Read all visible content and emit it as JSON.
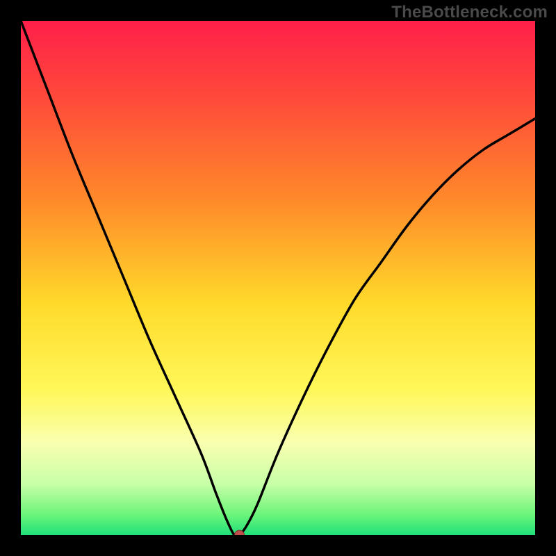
{
  "watermark": "TheBottleneck.com",
  "chart_data": {
    "type": "line",
    "title": "",
    "xlabel": "",
    "ylabel": "",
    "xlim": [
      0,
      100
    ],
    "ylim": [
      0,
      100
    ],
    "grid": false,
    "series": [
      {
        "name": "bottleneck-curve",
        "x": [
          0,
          5,
          10,
          15,
          20,
          25,
          30,
          35,
          38,
          40,
          41.5,
          42.5,
          44,
          46,
          50,
          55,
          60,
          65,
          70,
          75,
          80,
          85,
          90,
          95,
          100
        ],
        "y": [
          100,
          87,
          74,
          62,
          50,
          38,
          27,
          16,
          8,
          3,
          0,
          0,
          2,
          6,
          16,
          27,
          37,
          46,
          53,
          60,
          66,
          71,
          75,
          78,
          81
        ]
      }
    ],
    "marker": {
      "name": "operating-point",
      "x": 42.5,
      "y": 0,
      "color": "#c0504d"
    },
    "background_gradient": {
      "stops": [
        {
          "pct": 0,
          "color": "#ff1f4a"
        },
        {
          "pct": 15,
          "color": "#ff4a3a"
        },
        {
          "pct": 35,
          "color": "#ff8a2a"
        },
        {
          "pct": 55,
          "color": "#ffda2a"
        },
        {
          "pct": 72,
          "color": "#fff85a"
        },
        {
          "pct": 82,
          "color": "#f9ffb0"
        },
        {
          "pct": 90,
          "color": "#c8ffa8"
        },
        {
          "pct": 96,
          "color": "#6cf57a"
        },
        {
          "pct": 100,
          "color": "#1fe07a"
        }
      ]
    }
  }
}
